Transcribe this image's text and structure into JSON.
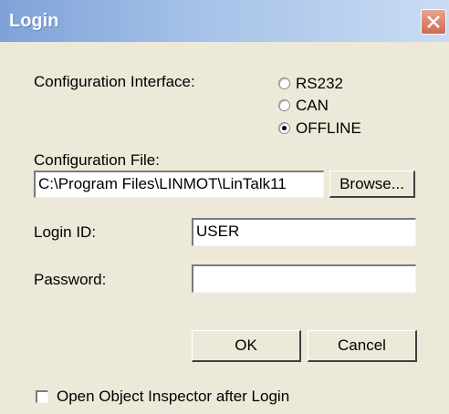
{
  "window": {
    "title": "Login"
  },
  "config_interface": {
    "label": "Configuration Interface:",
    "options": [
      {
        "label": "RS232",
        "selected": false
      },
      {
        "label": "CAN",
        "selected": false
      },
      {
        "label": "OFFLINE",
        "selected": true
      }
    ]
  },
  "config_file": {
    "label": "Configuration File:",
    "value": "C:\\Program Files\\LINMOT\\LinTalk11",
    "browse_label": "Browse..."
  },
  "login_id": {
    "label": "Login ID:",
    "value": "USER"
  },
  "password": {
    "label": "Password:",
    "value": ""
  },
  "buttons": {
    "ok_label": "OK",
    "cancel_label": "Cancel"
  },
  "inspector_option": {
    "label": "Open Object Inspector after Login",
    "checked": false
  },
  "colors": {
    "title_bar": "#7ea2d8",
    "close_button": "#cf6a50",
    "dialog_bg": "#ece9d8"
  },
  "icons": {
    "close": "close-x-icon"
  }
}
